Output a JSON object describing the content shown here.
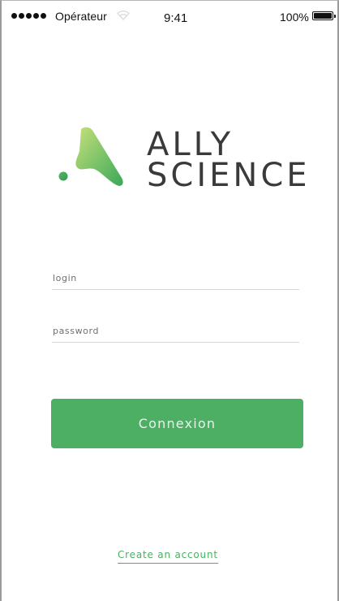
{
  "status_bar": {
    "carrier": "Opérateur",
    "time": "9:41",
    "battery_percent": "100%",
    "signal_icon": "signal-dots-icon",
    "wifi_icon": "wifi-icon",
    "battery_icon": "battery-icon",
    "battery_level": 1.0
  },
  "logo": {
    "line1": "ALLY",
    "line2": "SCIENCE",
    "colors": {
      "mark_gradient_start": "#c6e07a",
      "mark_gradient_end": "#3aa85a",
      "text": "#3a3a3a"
    }
  },
  "form": {
    "login_placeholder": "login",
    "login_value": "",
    "password_placeholder": "password",
    "password_value": "",
    "submit_label": "Connexion"
  },
  "footer": {
    "create_account_label": "Create an account"
  },
  "colors": {
    "accent": "#4caf63",
    "button_text": "#e7f5e9",
    "divider": "#d6d6d6"
  }
}
